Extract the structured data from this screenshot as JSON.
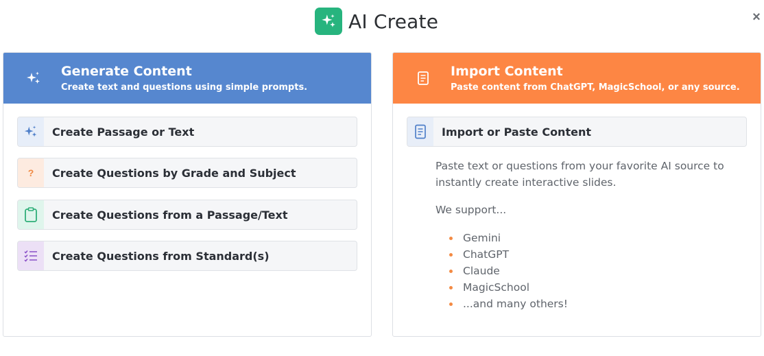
{
  "header": {
    "title": "AI Create",
    "close_label": "×",
    "accent": "#27b47e"
  },
  "generate": {
    "title": "Generate Content",
    "subtitle": "Create text and questions using simple prompts.",
    "color": "#5687cf",
    "icon": "sparkle-icon",
    "options": [
      {
        "label": "Create Passage or Text",
        "icon": "sparkle-icon"
      },
      {
        "label": "Create Questions by Grade and Subject",
        "icon": "question-mark-icon"
      },
      {
        "label": "Create Questions from a Passage/Text",
        "icon": "clipboard-icon"
      },
      {
        "label": "Create Questions from Standard(s)",
        "icon": "checklist-icon"
      }
    ]
  },
  "import": {
    "title": "Import Content",
    "subtitle": "Paste content from ChatGPT, MagicSchool, or any source.",
    "color": "#fd8644",
    "icon": "document-icon",
    "option_label": "Import or Paste Content",
    "description": "Paste text or questions from your favorite AI source to instantly create interactive slides.",
    "support_heading": "We support...",
    "supported": [
      "Gemini",
      "ChatGPT",
      "Claude",
      "MagicSchool",
      "...and many others!"
    ]
  }
}
